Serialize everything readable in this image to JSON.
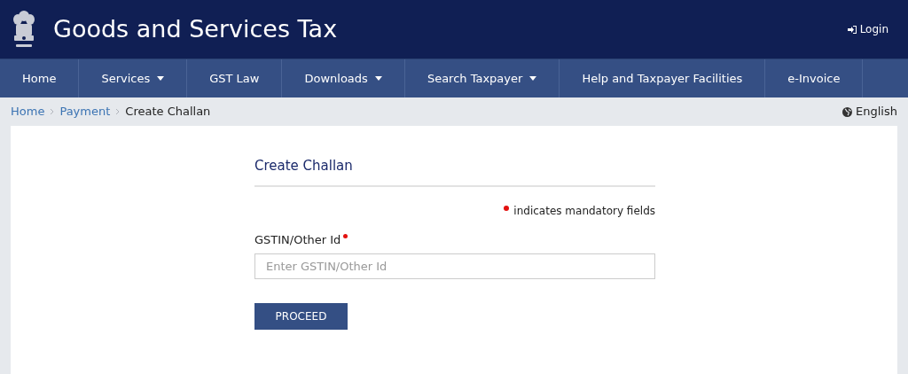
{
  "header": {
    "title": "Goods and Services Tax",
    "login": "Login"
  },
  "nav": [
    {
      "label": "Home",
      "dropdown": false
    },
    {
      "label": "Services",
      "dropdown": true
    },
    {
      "label": "GST Law",
      "dropdown": false
    },
    {
      "label": "Downloads",
      "dropdown": true
    },
    {
      "label": "Search Taxpayer",
      "dropdown": true
    },
    {
      "label": "Help and Taxpayer Facilities",
      "dropdown": false
    },
    {
      "label": "e-Invoice",
      "dropdown": false
    }
  ],
  "breadcrumbs": [
    {
      "label": "Home",
      "kind": "link"
    },
    {
      "label": "Payment",
      "kind": "link"
    },
    {
      "label": "Create Challan",
      "kind": "current"
    }
  ],
  "language": "English",
  "form": {
    "title": "Create Challan",
    "mandatory_note": "indicates mandatory fields",
    "field": {
      "label": "GSTIN/Other Id",
      "required": true,
      "placeholder": "Enter GSTIN/Other Id"
    },
    "button": "PROCEED"
  }
}
